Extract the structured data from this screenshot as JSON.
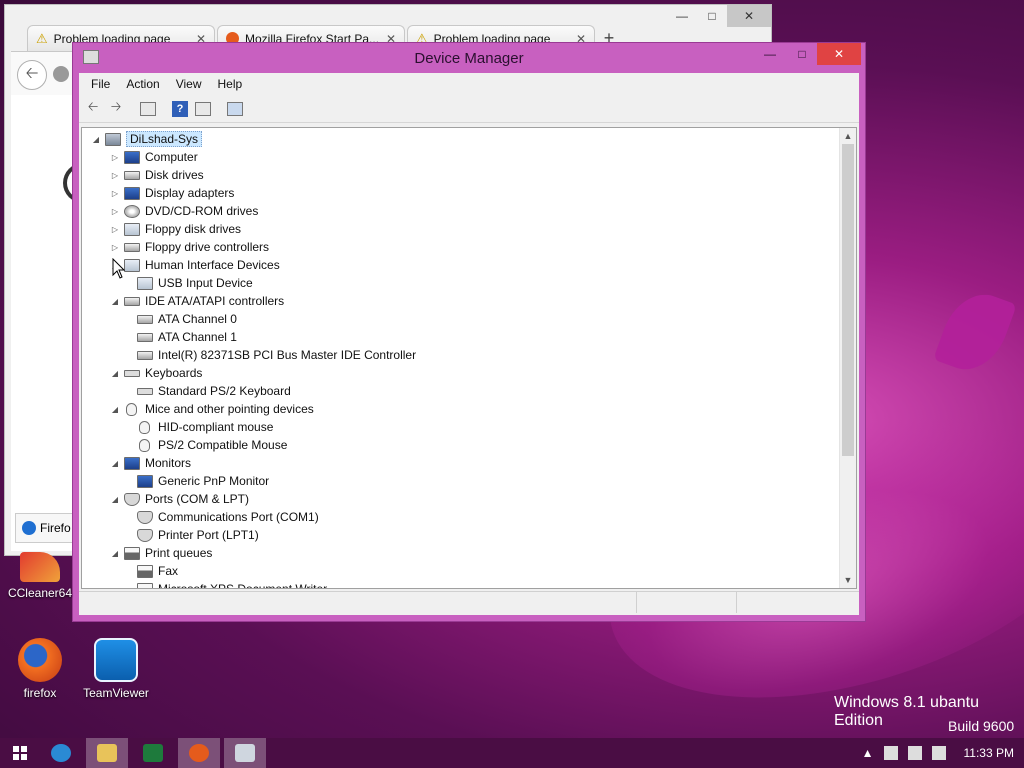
{
  "firefox": {
    "tabs": [
      {
        "label": "Problem loading page",
        "icon": "warning-icon"
      },
      {
        "label": "Mozilla Firefox Start Pa...",
        "icon": "firefox-icon"
      },
      {
        "label": "Problem loading page",
        "icon": "warning-icon"
      }
    ],
    "status_text": "Firefo"
  },
  "device_manager": {
    "title": "Device Manager",
    "menu": [
      "File",
      "Action",
      "View",
      "Help"
    ],
    "tree": [
      {
        "label": "DiLshad-Sys",
        "level": 0,
        "expander": "open",
        "icon": "computer-root-icon",
        "selected": true
      },
      {
        "label": "Computer",
        "level": 1,
        "expander": "closed",
        "icon": "monitor-icon"
      },
      {
        "label": "Disk drives",
        "level": 1,
        "expander": "closed",
        "icon": "disk-icon"
      },
      {
        "label": "Display adapters",
        "level": 1,
        "expander": "closed",
        "icon": "monitor-icon"
      },
      {
        "label": "DVD/CD-ROM drives",
        "level": 1,
        "expander": "closed",
        "icon": "disc-icon"
      },
      {
        "label": "Floppy disk drives",
        "level": 1,
        "expander": "closed",
        "icon": "floppy-icon"
      },
      {
        "label": "Floppy drive controllers",
        "level": 1,
        "expander": "closed",
        "icon": "controller-icon"
      },
      {
        "label": "Human Interface Devices",
        "level": 1,
        "expander": "open",
        "icon": "hid-icon"
      },
      {
        "label": "USB Input Device",
        "level": 2,
        "expander": "none",
        "icon": "hid-icon"
      },
      {
        "label": "IDE ATA/ATAPI controllers",
        "level": 1,
        "expander": "open",
        "icon": "controller-icon"
      },
      {
        "label": "ATA Channel 0",
        "level": 2,
        "expander": "none",
        "icon": "controller-icon"
      },
      {
        "label": "ATA Channel 1",
        "level": 2,
        "expander": "none",
        "icon": "controller-icon"
      },
      {
        "label": "Intel(R) 82371SB PCI Bus Master IDE Controller",
        "level": 2,
        "expander": "none",
        "icon": "controller-icon"
      },
      {
        "label": "Keyboards",
        "level": 1,
        "expander": "open",
        "icon": "keyboard-icon"
      },
      {
        "label": "Standard PS/2 Keyboard",
        "level": 2,
        "expander": "none",
        "icon": "keyboard-icon"
      },
      {
        "label": "Mice and other pointing devices",
        "level": 1,
        "expander": "open",
        "icon": "mouse-icon"
      },
      {
        "label": "HID-compliant mouse",
        "level": 2,
        "expander": "none",
        "icon": "mouse-icon"
      },
      {
        "label": "PS/2 Compatible Mouse",
        "level": 2,
        "expander": "none",
        "icon": "mouse-icon"
      },
      {
        "label": "Monitors",
        "level": 1,
        "expander": "open",
        "icon": "monitor-icon"
      },
      {
        "label": "Generic PnP Monitor",
        "level": 2,
        "expander": "none",
        "icon": "monitor-icon"
      },
      {
        "label": "Ports (COM & LPT)",
        "level": 1,
        "expander": "open",
        "icon": "port-icon"
      },
      {
        "label": "Communications Port (COM1)",
        "level": 2,
        "expander": "none",
        "icon": "port-icon"
      },
      {
        "label": "Printer Port (LPT1)",
        "level": 2,
        "expander": "none",
        "icon": "port-icon"
      },
      {
        "label": "Print queues",
        "level": 1,
        "expander": "open",
        "icon": "printer-icon"
      },
      {
        "label": "Fax",
        "level": 2,
        "expander": "none",
        "icon": "printer-icon"
      },
      {
        "label": "Microsoft XPS Document Writer",
        "level": 2,
        "expander": "none",
        "icon": "printer-icon"
      }
    ]
  },
  "desktop": {
    "icons": [
      {
        "label": "CCleaner64",
        "icon": "ccleaner-icon"
      },
      {
        "label": "firefox",
        "icon": "firefox-icon"
      },
      {
        "label": "TeamViewer",
        "icon": "teamviewer-icon"
      }
    ],
    "edition_text": "Windows 8.1 ubantu Edition",
    "build_text": "Build 9600"
  },
  "taskbar": {
    "clock": "11:33 PM",
    "buttons": [
      "ie-icon",
      "file-explorer-icon",
      "excel-icon",
      "firefox-icon",
      "device-manager-icon"
    ]
  },
  "colors": {
    "window_frame": "#c860c0",
    "close_button": "#e04343",
    "selection": "#cce8ff",
    "taskbar": "#4a0d44"
  }
}
